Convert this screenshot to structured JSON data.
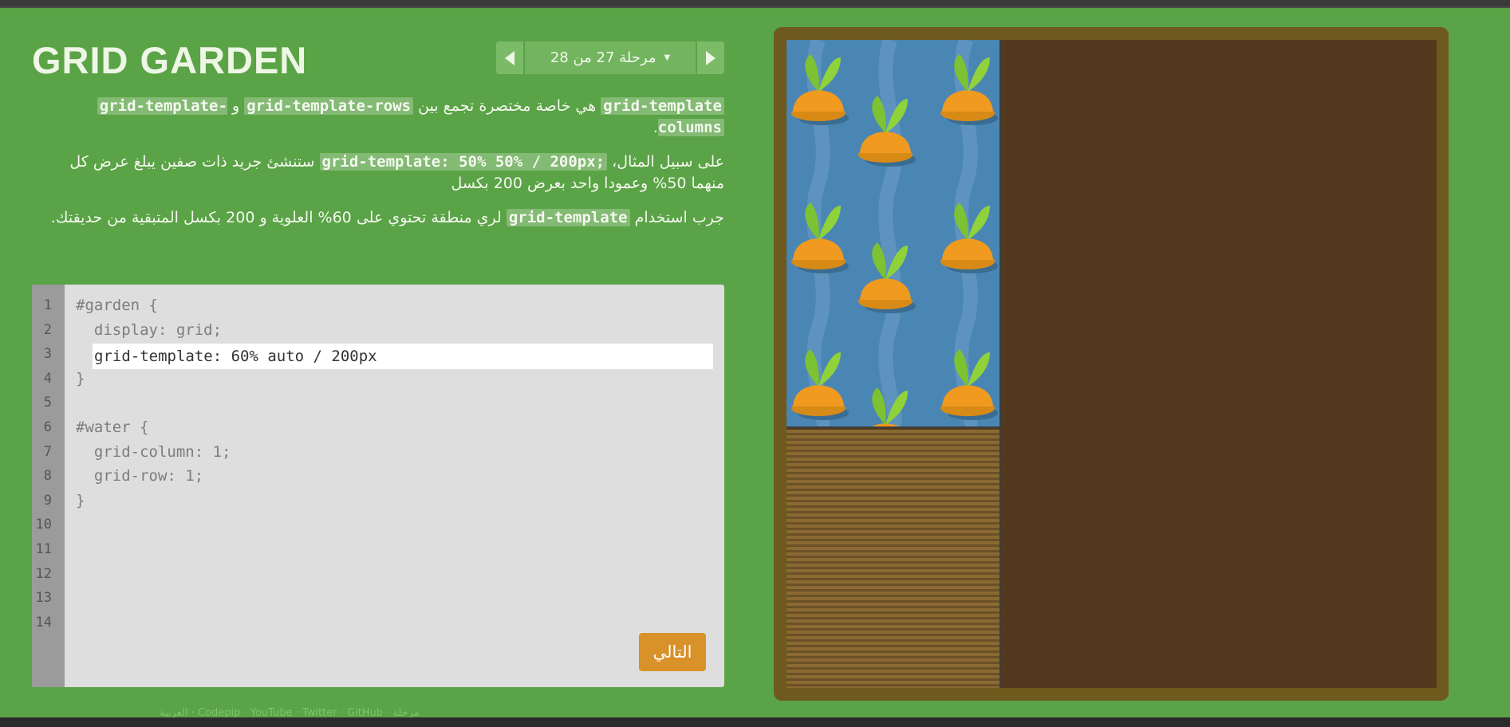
{
  "header": {
    "title": "GRID GARDEN"
  },
  "level_nav": {
    "label": "مرحلة  27 من 28",
    "caret": "▼"
  },
  "instructions": {
    "p1": {
      "code1": "grid-template",
      "text1": " هي خاصة مختصرة تجمع بين ",
      "code2": "grid-template-rows",
      "text2": " و ",
      "code3": "grid-template-columns",
      "text3": "."
    },
    "p2": {
      "text1": "على سبيل المثال، ",
      "code1": "grid-template: 50% 50% / 200px;",
      "text2": " ستنشئ جريد ذات صفين يبلغ عرض كل منهما 50% وعمودا واحد بعرض 200 بكسل"
    },
    "p3": {
      "text1": "جرب استخدام ",
      "code1": "grid-template",
      "text2": " لري منطقة تحتوي على 60% العلوية و 200 بكسل المتبقية من حديقتك."
    }
  },
  "editor": {
    "line_numbers": [
      "1",
      "2",
      "3",
      "4",
      "5",
      "6",
      "7",
      "8",
      "9",
      "10",
      "11",
      "12",
      "13",
      "14"
    ],
    "lines": [
      "#garden {",
      "  display: grid;",
      "",
      "}",
      "",
      "#water {",
      "  grid-column: 1;",
      "  grid-row: 1;",
      "}"
    ],
    "input_value": "grid-template: 60% auto / 200px",
    "next_label": "التالي"
  },
  "footer": {
    "text": "مرحلة · Codepip · YouTube · Twitter · GitHub · العربية"
  },
  "colors": {
    "background": "#5aa346",
    "water": "#4a86b4",
    "soil": "#8a6a32",
    "next_button": "#d9912a"
  }
}
